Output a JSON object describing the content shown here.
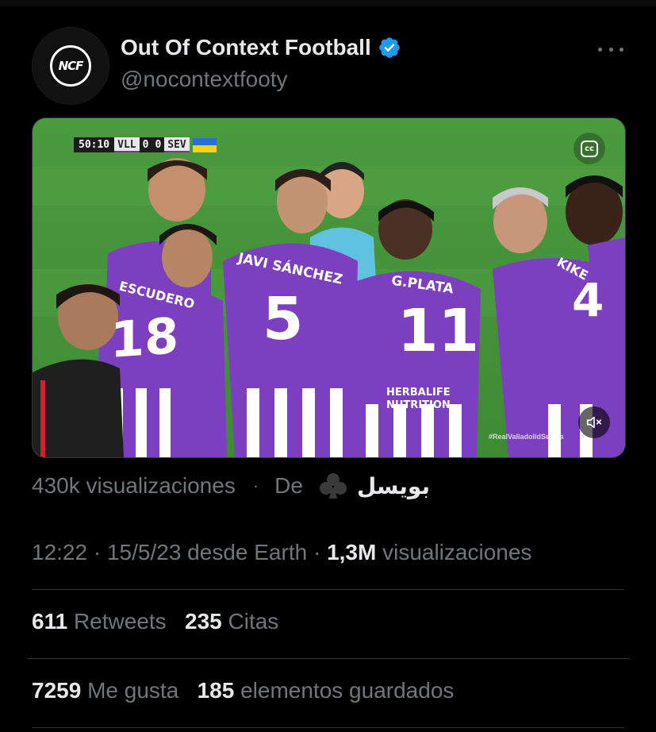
{
  "author": {
    "display_name": "Out Of Context Football",
    "handle": "@nocontextfooty",
    "avatar_text": "NCF",
    "verified_color": "#1d9bf0"
  },
  "media": {
    "scoreboard": {
      "clock": "50:10",
      "home": "VLL",
      "home_score": "0",
      "away_score": "0",
      "away": "SEV"
    },
    "tv_logo_text": "cc",
    "player_names": [
      "ESCUDERO",
      "JAVI SÁNCHEZ",
      "G.PLATA",
      "KIKE"
    ],
    "player_numbers": [
      "18",
      "5",
      "11",
      "4"
    ],
    "sponsor": [
      "HERBALIFE",
      "NUTRITION"
    ],
    "watermark": "#RealValladolidSevilla",
    "mute_icon": "speaker-muted-icon"
  },
  "media_views": {
    "views": "430k visualizaciones",
    "separator": "·",
    "from_label": "De",
    "source_name": "بويسل",
    "source_icon": "club-suit-icon"
  },
  "timestamp": {
    "time": "12:22",
    "date": "15/5/23",
    "source": "desde Earth",
    "views_count": "1,3M",
    "views_label": "visualizaciones"
  },
  "stats": {
    "retweets_count": "611",
    "retweets_label": "Retweets",
    "quotes_count": "235",
    "quotes_label": "Citas",
    "likes_count": "7259",
    "likes_label": "Me gusta",
    "bookmarks_count": "185",
    "bookmarks_label": "elementos guardados"
  },
  "colors": {
    "background": "#000000",
    "primary_text": "#e7e9ea",
    "secondary_text": "#71767b",
    "divider": "#2f3336",
    "verified": "#1d9bf0",
    "kit_purple": "#7b3fbf"
  }
}
